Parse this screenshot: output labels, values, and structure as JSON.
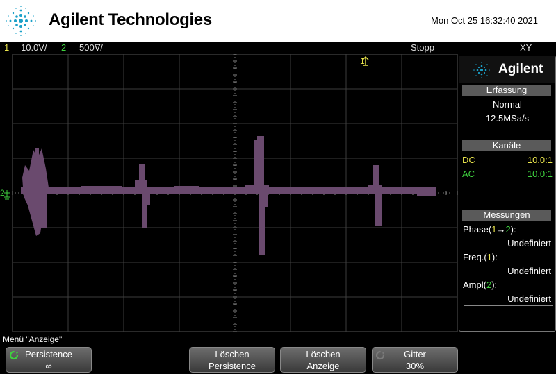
{
  "header": {
    "brand": "Agilent Technologies",
    "datetime": "Mon Oct 25 16:32:40 2021"
  },
  "status": {
    "ch1_num": "1",
    "ch1_scale": "10.0V/",
    "ch2_num": "2",
    "ch2_scale": "500∇/",
    "run_state": "Stopp",
    "mode": "XY"
  },
  "markers": {
    "trigger_marker": "1",
    "channel_marker": "2"
  },
  "sidepanel": {
    "brand": "Agilent",
    "acquisition": {
      "title": "Erfassung",
      "mode": "Normal",
      "rate": "12.5MSa/s"
    },
    "channels": {
      "title": "Kanäle",
      "rows": [
        {
          "coupling": "DC",
          "probe": "10.0:1",
          "color": "#e8e34b"
        },
        {
          "coupling": "AC",
          "probe": "10.0:1",
          "color": "#3fd23f"
        }
      ]
    },
    "measurements": {
      "title": "Messungen",
      "items": [
        {
          "label_prefix": "Phase(",
          "label_ch": "1",
          "label_mid": "→",
          "label_ch2": "2",
          "label_suffix": "):",
          "value": "Undefiniert"
        },
        {
          "label_prefix": "Freq.(",
          "label_ch": "1",
          "label_suffix": "):",
          "value": "Undefiniert"
        },
        {
          "label_prefix": "Ampl(",
          "label_ch": "2",
          "label_suffix": "):",
          "value": "Undefiniert"
        }
      ]
    }
  },
  "menu": {
    "title": "Menü \"Anzeige\"",
    "softkeys": [
      {
        "line1": "Persistence",
        "line2": "∞"
      },
      {
        "line1": "Löschen",
        "line2": "Persistence"
      },
      {
        "line1": "Löschen",
        "line2": "Anzeige"
      },
      {
        "line1": "Gitter",
        "line2": "30%"
      }
    ]
  },
  "colors": {
    "trace": "#6a4a6e",
    "channel1": "#e8e34b",
    "channel2": "#3fd23f"
  }
}
